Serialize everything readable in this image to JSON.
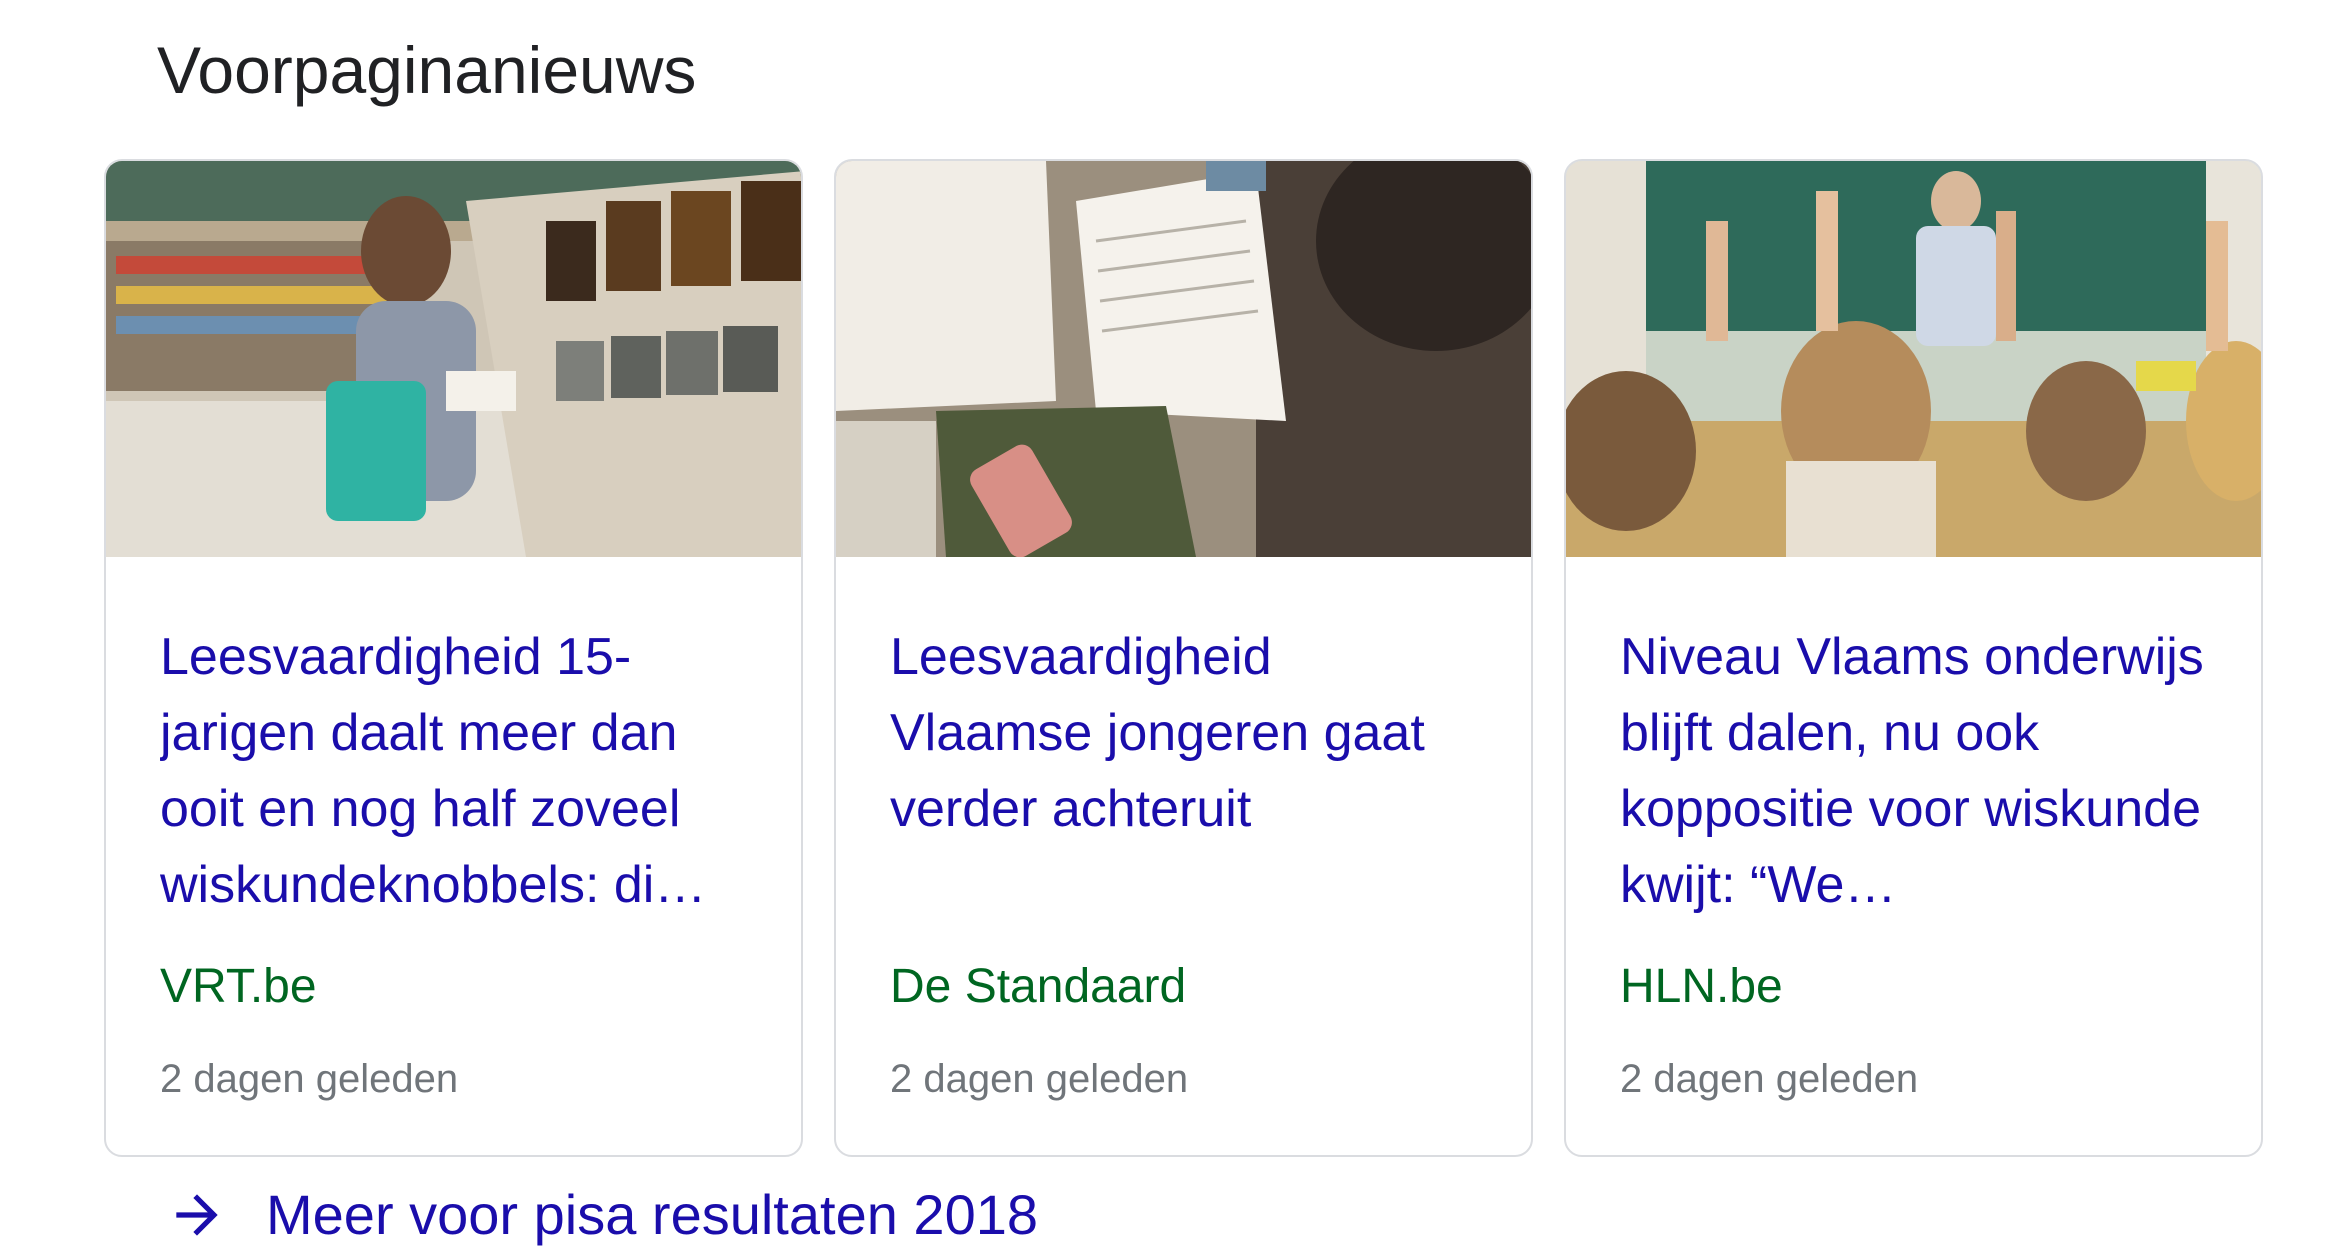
{
  "section": {
    "title": "Voorpaginanieuws"
  },
  "cards": [
    {
      "headline": "Leesvaardigheid 15-jarigen daalt meer dan ooit en nog half zoveel wiskundeknobbels: di…",
      "source": "VRT.be",
      "age": "2 dagen geleden",
      "image": "photo-girl-reading-in-bookstore"
    },
    {
      "headline": "Leesvaardigheid Vlaamse jongeren gaat verder achteruit",
      "source": "De Standaard",
      "age": "2 dagen geleden",
      "image": "photo-books-and-phone-on-desk"
    },
    {
      "headline": "Niveau Vlaams onderwijs blijft dalen, nu ook koppositie voor wiskunde kwijt: “We…",
      "source": "HLN.be",
      "age": "2 dagen geleden",
      "image": "photo-classroom-raised-hands"
    }
  ],
  "more": {
    "label": "Meer voor pisa resultaten 2018",
    "icon": "arrow-right-icon"
  },
  "colors": {
    "link": "#1a0dab",
    "source": "#006621",
    "meta": "#70757a",
    "border": "#dadce0"
  }
}
